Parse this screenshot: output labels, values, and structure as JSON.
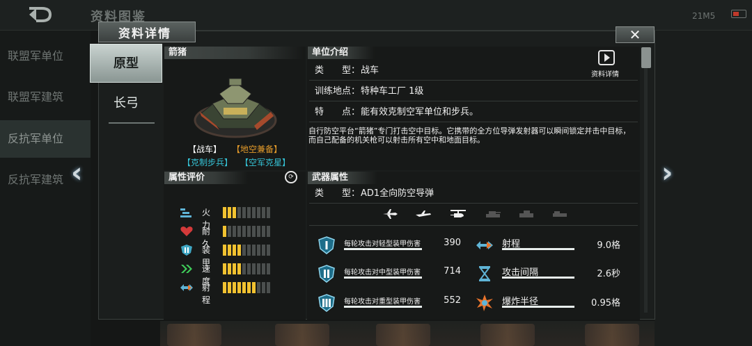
{
  "background": {
    "title": "资料图鉴",
    "signal": "21M5",
    "sidebar": [
      "联盟军单位",
      "联盟军建筑",
      "反抗军单位",
      "反抗军建筑"
    ]
  },
  "dialog": {
    "title": "资料详情",
    "close": "✕",
    "tabs": [
      "原型",
      "长弓"
    ]
  },
  "unit": {
    "name": "箭猪",
    "tags": [
      {
        "text": "【战车】",
        "color": "#ffffff"
      },
      {
        "text": "【地空兼备】",
        "color": "#e39a2a"
      },
      {
        "text": "【克制步兵】",
        "color": "#35c3d6"
      },
      {
        "text": "【空军克星】",
        "color": "#35c3d6"
      }
    ]
  },
  "attributes": {
    "title": "属性评价",
    "stats": [
      {
        "label": "火力",
        "icon": "firepower-icon",
        "value": 3,
        "max": 10
      },
      {
        "label": "耐久",
        "icon": "heart-icon",
        "value": 1,
        "max": 10
      },
      {
        "label": "装甲",
        "icon": "armor-icon",
        "value": 4,
        "max": 10
      },
      {
        "label": "速度",
        "icon": "speed-icon",
        "value": 4,
        "max": 10
      },
      {
        "label": "射程",
        "icon": "range-icon",
        "value": 7,
        "max": 10
      }
    ]
  },
  "intro": {
    "title": "单位介绍",
    "video_label": "资料详情",
    "rows": [
      {
        "key": "类　　型：",
        "value": "战车"
      },
      {
        "key": "训练地点：",
        "value": "特种车工厂 1级"
      },
      {
        "key": "特　　点：",
        "value": "能有效克制空军单位和步兵。"
      }
    ],
    "description": "自行防空平台“箭猪”专门打击空中目标。它携带的全方位导弹发射器可以瞬间锁定并击中目标，而自己配备的机关枪可以射击所有空中和地面目标。"
  },
  "weapon": {
    "title": "武器属性",
    "type_key": "类　　型：",
    "type_value": "AD1全向防空导弹",
    "targets": [
      {
        "icon": "jet-icon",
        "active": true
      },
      {
        "icon": "plane-icon",
        "active": true
      },
      {
        "icon": "helicopter-icon",
        "active": true
      },
      {
        "icon": "tank-icon",
        "active": false
      },
      {
        "icon": "vehicle-icon",
        "active": false
      },
      {
        "icon": "infantry-icon",
        "active": false
      }
    ],
    "damage": [
      {
        "label": "每轮攻击对轻型装甲伤害",
        "value": "390",
        "icon": "armor-light-icon"
      },
      {
        "label": "每轮攻击对中型装甲伤害",
        "value": "714",
        "icon": "armor-medium-icon"
      },
      {
        "label": "每轮攻击对重型装甲伤害",
        "value": "552",
        "icon": "armor-heavy-icon"
      }
    ],
    "props": [
      {
        "label": "射程",
        "value": "9.0格",
        "icon": "range-icon"
      },
      {
        "label": "攻击间隔",
        "value": "2.6秒",
        "icon": "hourglass-icon"
      },
      {
        "label": "爆炸半径",
        "value": "0.95格",
        "icon": "explosion-icon"
      }
    ]
  }
}
